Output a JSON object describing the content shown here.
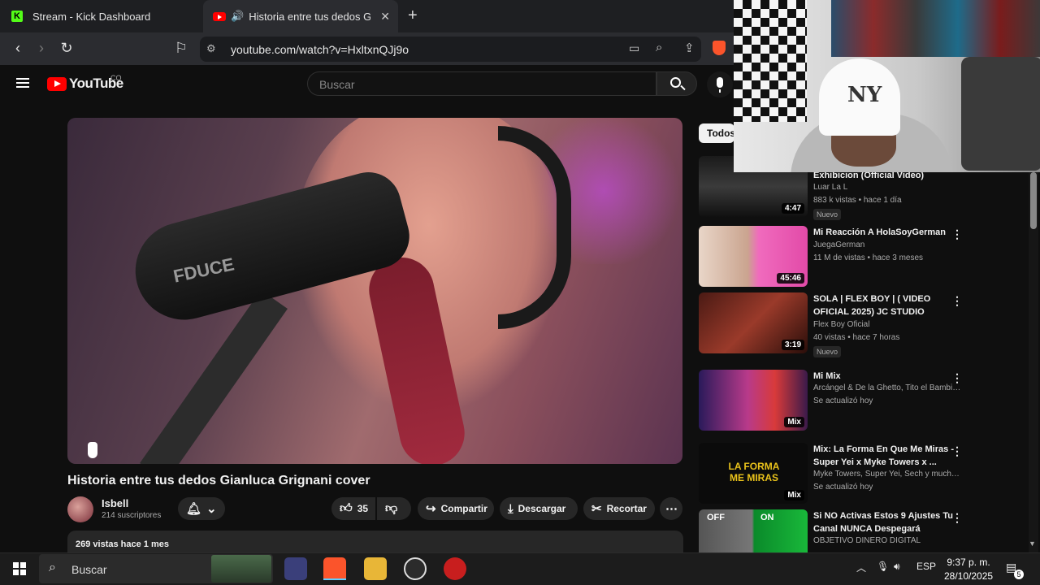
{
  "browser": {
    "tabs": [
      {
        "label": "Stream - Kick Dashboard",
        "favicon": "kick-icon"
      },
      {
        "label": "Historia entre tus dedos Gian",
        "favicon": "youtube-icon"
      }
    ],
    "url": "youtube.com/watch?v=HxltxnQJj9o"
  },
  "youtube": {
    "logo_text": "YouTube",
    "country": "CO",
    "search_placeholder": "Buscar"
  },
  "video": {
    "title": "Historia entre tus dedos Gianluca Grignani cover",
    "mic_brand": "FDUCE",
    "channel": "Isbell",
    "subscribers": "214 suscriptores",
    "likes": "35",
    "share_label": "Compartir",
    "download_label": "Descargar",
    "clip_label": "Recortar",
    "desc_meta": "269 vistas  hace 1 mes"
  },
  "sidebar": {
    "chip": "Todos",
    "items": [
      {
        "title": "Exhibicion (Official Video)",
        "channel": "Luar La L",
        "meta": "883 k vistas • hace 1 día",
        "badge": "Nuevo",
        "duration": "4:47"
      },
      {
        "title": "Mi Reacción A HolaSoyGerman",
        "channel": "JuegaGerman",
        "meta": "11 M de vistas • hace 3 meses",
        "badge": "",
        "duration": "45:46"
      },
      {
        "title": "SOLA | FLEX BOY | ( VIDEO OFICIAL 2025) JC STUDIO",
        "channel": "Flex Boy Oficial",
        "meta": "40 vistas • hace 7 horas",
        "badge": "Nuevo",
        "duration": "3:19"
      },
      {
        "title": "Mi Mix",
        "channel": "Arcángel & De la Ghetto, Tito el Bambino,...",
        "meta": "Se actualizó hoy",
        "badge": "",
        "duration": "Mix"
      },
      {
        "title": "Mix: La Forma En Que Me Miras - Super Yei x Myke Towers x ...",
        "channel": "Myke Towers, Super Yei, Sech y muchos ...",
        "meta": "Se actualizó hoy",
        "badge": "",
        "duration": "Mix"
      },
      {
        "title": "Si NO Activas Estos 9 Ajustes Tu Canal NUNCA Despegará",
        "channel": "OBJETIVO DINERO DIGITAL",
        "meta": "",
        "badge": "",
        "duration": ""
      }
    ],
    "thumb_texts": {
      "forma": "LA FORMA ME MIRAS",
      "off": "OFF",
      "on": "ON"
    }
  },
  "taskbar": {
    "search_label": "Buscar",
    "lang": "ESP",
    "time": "9:37 p. m.",
    "date": "28/10/2025",
    "notif_count": "5"
  }
}
